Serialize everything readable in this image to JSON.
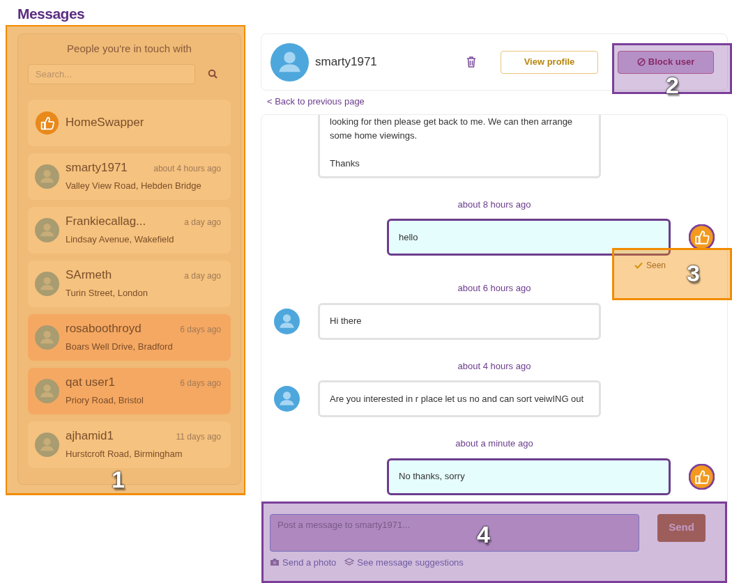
{
  "page_title": "Messages",
  "contacts_panel": {
    "title": "People you're in touch with",
    "search": {
      "placeholder": "Search..."
    },
    "contacts": [
      {
        "kind": "system",
        "name": "HomeSwapper",
        "unread": false
      },
      {
        "kind": "user",
        "name": "smarty1971",
        "time": "about 4 hours ago",
        "address": "Valley View Road, Hebden Bridge",
        "unread": false
      },
      {
        "kind": "user",
        "name": "Frankiecallag...",
        "time": "a day ago",
        "address": "Lindsay Avenue, Wakefield",
        "unread": false
      },
      {
        "kind": "user",
        "name": "SArmeth",
        "time": "a day ago",
        "address": "Turin Street, London",
        "unread": false
      },
      {
        "kind": "user",
        "name": "rosaboothroyd",
        "time": "6 days ago",
        "address": "Boars Well Drive, Bradford",
        "unread": true
      },
      {
        "kind": "user",
        "name": "qat user1",
        "time": "6 days ago",
        "address": "Priory Road, Bristol",
        "unread": true
      },
      {
        "kind": "user",
        "name": "ajhamid1",
        "time": "11 days ago",
        "address": "Hurstcroft Road, Birmingham",
        "unread": false
      }
    ]
  },
  "conversation": {
    "name": "smarty1971",
    "view_profile": "View profile",
    "block_user": "Block user",
    "back_link": "< Back to previous page",
    "messages": [
      {
        "kind": "incoming",
        "paragraphs": [
          "looking for then please get back to me. We can then arrange some home viewings.",
          "Thanks"
        ]
      },
      {
        "kind": "outgoing",
        "time": "about 8 hours ago",
        "text": "hello",
        "seen": "Seen"
      },
      {
        "kind": "incoming",
        "time": "about 6 hours ago",
        "text": "Hi there"
      },
      {
        "kind": "incoming",
        "time": "about 4 hours ago",
        "text": "Are you interested in r place let us no and can sort veiwING out"
      },
      {
        "kind": "outgoing",
        "time": "about a minute ago",
        "text": "No thanks, sorry"
      }
    ],
    "composer": {
      "placeholder": "Post a message to smarty1971...",
      "send": "Send",
      "send_photo": "Send a photo",
      "suggestions": "See message suggestions"
    }
  },
  "annotations": [
    {
      "label": "1",
      "color": "#f28c00"
    },
    {
      "label": "2",
      "color": "#7b3f9a"
    },
    {
      "label": "3",
      "color": "#f28c00"
    },
    {
      "label": "4",
      "color": "#7b3f9a"
    }
  ]
}
